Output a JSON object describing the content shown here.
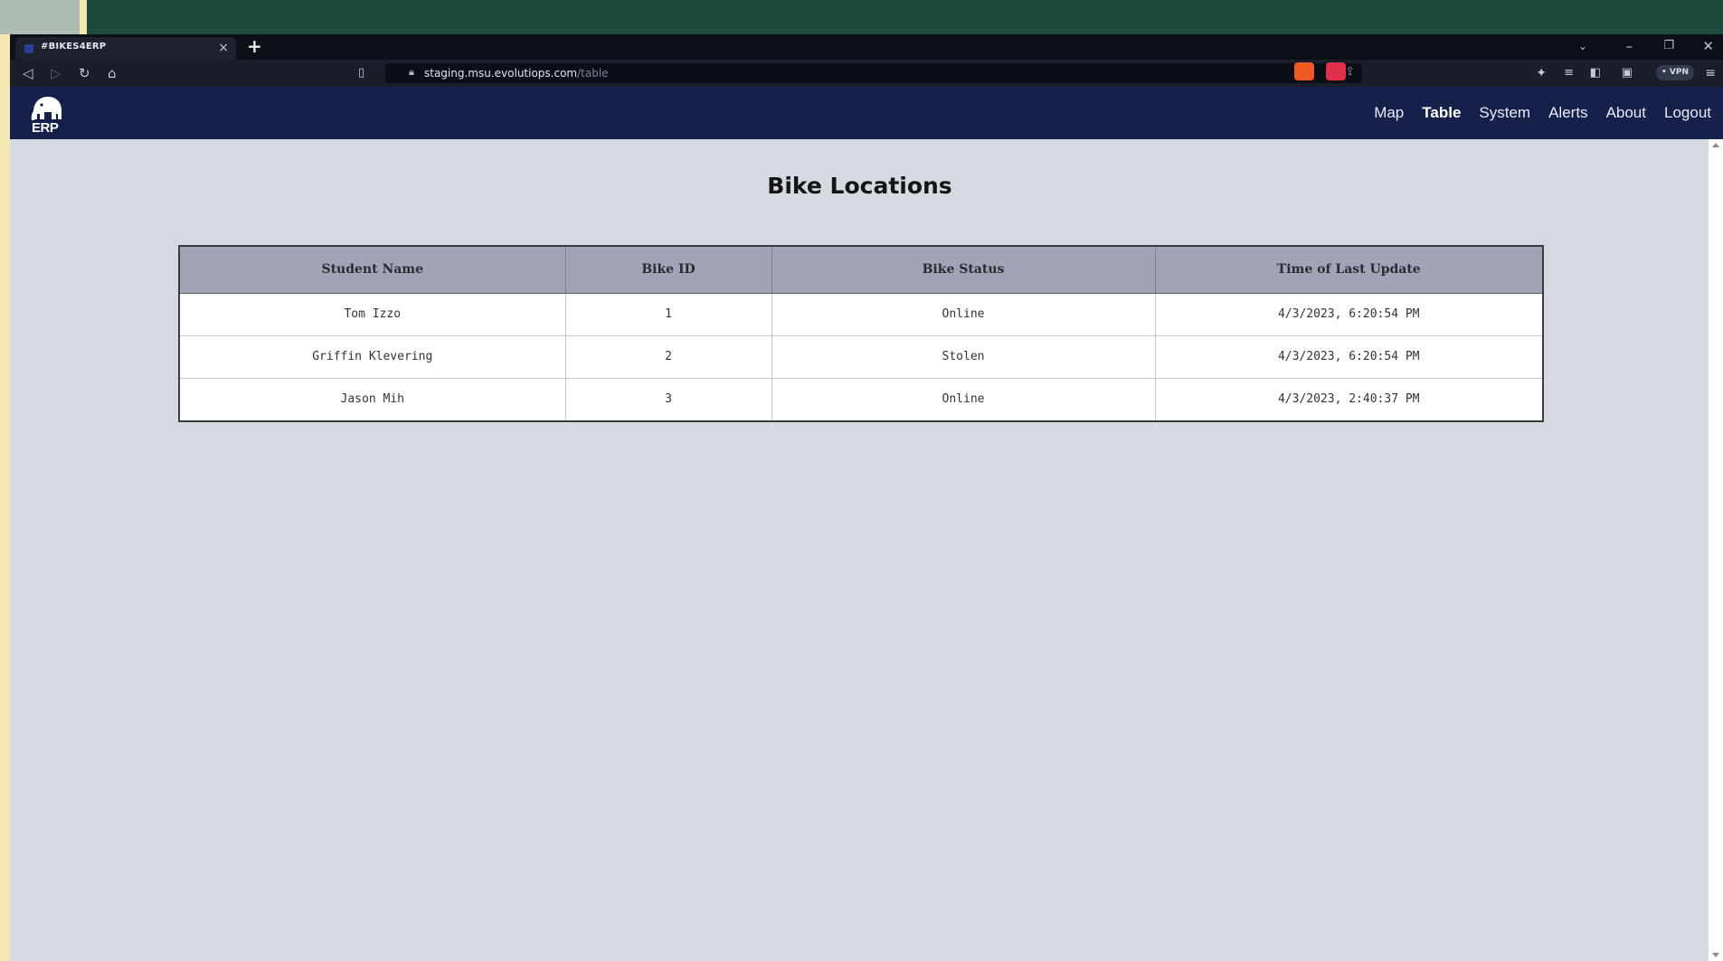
{
  "browser": {
    "tab_title": "#BIKES4ERP",
    "tab_close": "×",
    "new_tab": "+",
    "url_host": "staging.msu.evolutiops.com",
    "url_path": "/table",
    "vpn_label": "• VPN",
    "brand_colors": {
      "nav": "#15204b",
      "page_bg": "#d5d9e1",
      "header_row": "#a0a4b6"
    }
  },
  "app": {
    "logo_text": "ERP",
    "nav": {
      "map": "Map",
      "table": "Table",
      "system": "System",
      "alerts": "Alerts",
      "about": "About",
      "logout": "Logout"
    },
    "active_nav": "Table"
  },
  "page": {
    "title": "Bike Locations",
    "table": {
      "headers": {
        "name": "Student Name",
        "id": "Bike ID",
        "status": "Bike Status",
        "updated": "Time of Last Update"
      },
      "rows": [
        {
          "name": "Tom Izzo",
          "id": "1",
          "status": "Online",
          "updated": "4/3/2023, 6:20:54 PM"
        },
        {
          "name": "Griffin Klevering",
          "id": "2",
          "status": "Stolen",
          "updated": "4/3/2023, 6:20:54 PM"
        },
        {
          "name": "Jason Mih",
          "id": "3",
          "status": "Online",
          "updated": "4/3/2023, 2:40:37 PM"
        }
      ]
    }
  }
}
